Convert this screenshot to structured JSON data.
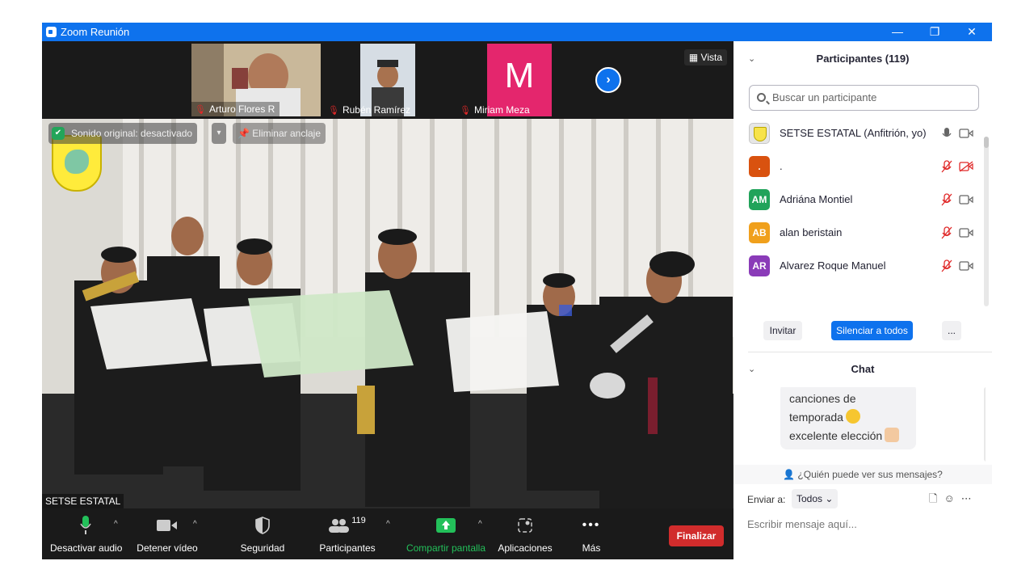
{
  "window": {
    "title": "Zoom Reunión",
    "controls": {
      "minimize": "—",
      "restore": "❐",
      "close": "✕"
    }
  },
  "thumbnails": [
    {
      "name": "Arturo Flores R"
    },
    {
      "name": "Rubén Ramírez"
    },
    {
      "name": "Miriam Meza",
      "initial": "M"
    }
  ],
  "view_button": "Vista",
  "stage": {
    "sound_label": "Sonido original: desactivado",
    "unpin_label": "Eliminar anclaje",
    "speaker_name": "SETSE ESTATAL"
  },
  "toolbar": {
    "audio_label": "Desactivar audio",
    "video_label": "Detener vídeo",
    "security_label": "Seguridad",
    "participants_label": "Participantes",
    "participants_count": "119",
    "share_label": "Compartir pantalla",
    "apps_label": "Aplicaciones",
    "more_label": "Más",
    "end_label": "Finalizar"
  },
  "participants_panel": {
    "title": "Participantes (119)",
    "search_placeholder": "Buscar un participante",
    "rows": [
      {
        "initials": "",
        "name": "SETSE ESTATAL (Anfitrión, yo)",
        "color": "#e6e6e6",
        "muted": false,
        "cam_off": false
      },
      {
        "initials": ".",
        "name": ".",
        "color": "#d9520f",
        "muted": true,
        "cam_off": true
      },
      {
        "initials": "AM",
        "name": "Adriána Montiel",
        "color": "#21a35a",
        "muted": true,
        "cam_off": false
      },
      {
        "initials": "AB",
        "name": "alan beristain",
        "color": "#f0a01c",
        "muted": true,
        "cam_off": false
      },
      {
        "initials": "AR",
        "name": "Alvarez Roque Manuel",
        "color": "#8a3bb8",
        "muted": true,
        "cam_off": false
      }
    ],
    "invite_label": "Invitar",
    "mute_all_label": "Silenciar a todos",
    "more_label": "..."
  },
  "chat_panel": {
    "title": "Chat",
    "message_lines": [
      "canciones de",
      "temporada",
      "excelente elección"
    ],
    "who_can_see": "¿Quién puede ver sus mensajes?",
    "send_to_label": "Enviar a:",
    "send_to_value": "Todos",
    "input_placeholder": "Escribir mensaje aquí..."
  },
  "colors": {
    "accent": "#0e72ed",
    "end": "#d12c2c",
    "share": "#23c05a",
    "muted_red": "#e02828"
  },
  "icons": [
    "zoom-icon",
    "shield-icon",
    "pin-icon",
    "microphone-icon",
    "video-camera-icon",
    "security-shield-icon",
    "participants-icon",
    "share-screen-icon",
    "apps-icon",
    "more-dots-icon",
    "search-icon",
    "chevron-down-icon",
    "file-icon",
    "emoji-icon"
  ]
}
